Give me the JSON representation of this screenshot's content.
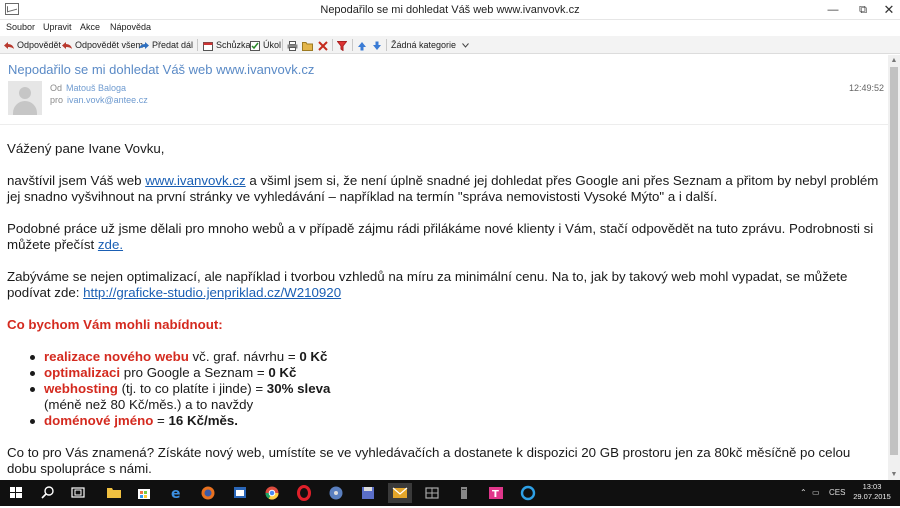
{
  "window": {
    "title": "Nepodařilo se mi dohledat Váš web www.ivanvovk.cz",
    "controls": {
      "minimize": "—",
      "maximize": "⧉",
      "close": "✕"
    }
  },
  "menu": [
    "Soubor",
    "Upravit",
    "Akce",
    "Nápověda"
  ],
  "toolbar": {
    "reply": "Odpovědět",
    "reply_all": "Odpovědět všem",
    "forward": "Předat dál",
    "meeting": "Schůzka",
    "task": "Úkol",
    "category": "Žádná kategorie"
  },
  "header": {
    "subject": "Nepodařilo se mi dohledat Váš web www.ivanvovk.cz",
    "from_label": "Od",
    "from_value": "Matouš Baloga",
    "to_label": "pro",
    "to_value": "ivan.vovk@antee.cz",
    "time": "12:49:52"
  },
  "message": {
    "greeting": "Vážený pane Ivane Vovku,",
    "p1_a": "navštívil jsem Váš web ",
    "p1_link": "www.ivanvovk.cz",
    "p1_b": " a všiml jsem si, že není úplně snadné jej dohledat přes Google ani přes Seznam a přitom by nebyl problém jej snadno vyšvihnout na první stránky ve vyhledávání – například na termín \"správa nemovistosti Vysoké Mýto\" a i další.",
    "p2_a": "Podobné práce už jsme dělali pro mnoho webů a v případě zájmu rádi přilákáme nové klienty i Vám, stačí odpovědět na tuto zprávu. Podrobnosti si můžete přečíst ",
    "p2_link": "zde.",
    "p3_a": "Zabýváme se nejen optimalizací, ale například i tvorbou vzhledů na míru za minimální cenu. Na to, jak by takový web mohl vypadat, se můžete podívat zde: ",
    "p3_link": "http://graficke-studio.jenpriklad.cz/W210920",
    "offer_heading": "Co bychom Vám mohli nabídnout:",
    "offers": [
      {
        "name": "realizace nového webu",
        "desc": " vč. graf. návrhu = ",
        "price": "0 Kč",
        "extra": ""
      },
      {
        "name": "optimalizaci",
        "desc": " pro Google a Seznam = ",
        "price": "0 Kč",
        "extra": ""
      },
      {
        "name": "webhosting",
        "desc": " (tj. to co platíte i jinde) = ",
        "price": "30% sleva",
        "extra": "(méně než 80 Kč/měs.) a to navždy"
      },
      {
        "name": "doménové jméno",
        "desc": " = ",
        "price": "16 Kč/měs.",
        "extra": ""
      }
    ],
    "p4": "Co to pro Vás znamená? Získáte nový web, umístíte se ve vyhledávačích a dostanete k dispozici 20 GB prostoru jen za 80kč měsíčně po celou dobu spolupráce s námi."
  },
  "taskbar": {
    "language": "CES",
    "time": "13:03",
    "date": "29.07.2015"
  },
  "colors": {
    "subject": "#5a8ac6",
    "offer_red": "#d42a1f",
    "link": "#1a5fb4",
    "taskbar": "#101010"
  }
}
